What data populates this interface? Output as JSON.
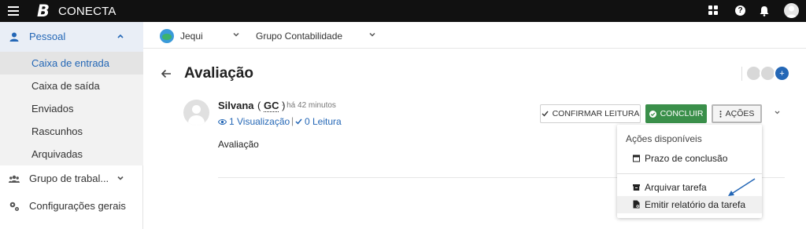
{
  "app": {
    "logo_letter": "B",
    "name": "CONECTA"
  },
  "topbar": {
    "help_label": "?",
    "icons": [
      "menu-icon",
      "apps-icon",
      "help-icon",
      "bell-icon",
      "user-avatar"
    ]
  },
  "sidebar": {
    "groups": [
      {
        "label": "Pessoal",
        "icon": "person-icon",
        "expanded": true
      },
      {
        "label": "Grupo de trabal...",
        "icon": "group-icon",
        "expanded": false
      },
      {
        "label": "Configurações gerais",
        "icon": "gears-icon",
        "expanded": false
      }
    ],
    "items": [
      {
        "label": "Caixa de entrada",
        "selected": true
      },
      {
        "label": "Caixa de saída",
        "selected": false
      },
      {
        "label": "Enviados",
        "selected": false
      },
      {
        "label": "Rascunhos",
        "selected": false
      },
      {
        "label": "Arquivadas",
        "selected": false
      }
    ]
  },
  "context": {
    "organization": "Jequi",
    "group": "Grupo Contabilidade"
  },
  "task": {
    "title": "Avaliação",
    "add_participant_label": "+"
  },
  "message": {
    "sender": "Silvana",
    "sender_tag_open": "(",
    "sender_tag": "GC",
    "sender_tag_close": ")",
    "time": "- há 42 minutos",
    "views": "1 Visualização",
    "separator": "|",
    "reads": "0 Leitura",
    "body": "Avaliação"
  },
  "actions": {
    "confirm": "CONFIRMAR LEITURA",
    "conclude": "CONCLUIR",
    "more": "AÇÕES",
    "accent": "#3a8f4a"
  },
  "dropdown": {
    "header": "Ações disponíveis",
    "items": [
      {
        "label": "Prazo de conclusão",
        "icon": "calendar-icon"
      },
      {
        "label": "Arquivar tarefa",
        "icon": "archive-icon"
      },
      {
        "label": "Emitir relatório da tarefa",
        "icon": "report-icon"
      }
    ]
  },
  "colors": {
    "primary": "#2467b6",
    "topbar": "#111111"
  }
}
